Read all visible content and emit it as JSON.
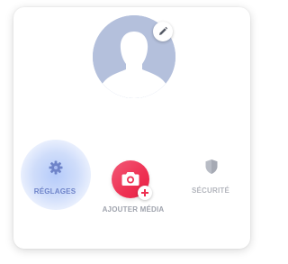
{
  "profile": {
    "avatar_icon": "person-silhouette-icon",
    "edit_icon": "pencil-icon"
  },
  "actions": {
    "settings": {
      "label": "RÉGLAGES",
      "icon": "gear-icon"
    },
    "media": {
      "label": "AJOUTER MÉDIA",
      "icon": "camera-icon",
      "badge_icon": "plus-icon"
    },
    "security": {
      "label": "SÉCURITÉ",
      "icon": "shield-icon"
    }
  },
  "colors": {
    "avatar": "#b4c0dc",
    "media_button": "#ee3052",
    "settings_label_active": "#6f84c9",
    "inactive_label": "#b3b6bd"
  }
}
